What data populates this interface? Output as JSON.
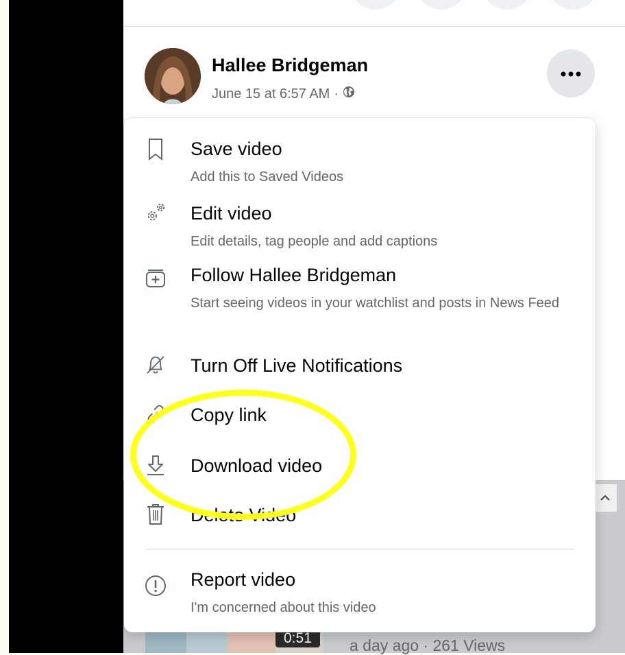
{
  "post": {
    "author": "Hallee Bridgeman",
    "timestamp": "June 15 at 6:57 AM",
    "separator": "·",
    "privacy_icon": "globe-icon",
    "more_icon": "more-horizontal-icon"
  },
  "menu": {
    "items": [
      {
        "label": "Save video",
        "sub": "Add this to Saved Videos",
        "icon": "bookmark-icon"
      },
      {
        "label": "Edit video",
        "sub": "Edit details, tag people and add captions",
        "icon": "gears-icon"
      },
      {
        "label": "Follow Hallee Bridgeman",
        "sub": "Start seeing videos in your watchlist and posts in News Feed",
        "icon": "follow-plus-icon"
      },
      {
        "label": "Turn Off Live Notifications",
        "sub": "",
        "icon": "bell-off-icon"
      },
      {
        "label": "Copy link",
        "sub": "",
        "icon": "link-icon"
      },
      {
        "label": "Download video",
        "sub": "",
        "icon": "download-icon"
      },
      {
        "label": "Delete Video",
        "sub": "",
        "icon": "trash-icon"
      },
      {
        "label": "Report video",
        "sub": "I'm concerned about this video",
        "icon": "report-icon"
      }
    ]
  },
  "video_list": {
    "duration": "0:51",
    "stats": "a day ago · 261 Views"
  },
  "colors": {
    "highlight": "#ffff1f",
    "text_primary": "#050505",
    "text_secondary": "#65676b",
    "menu_background": "#ffffff"
  }
}
